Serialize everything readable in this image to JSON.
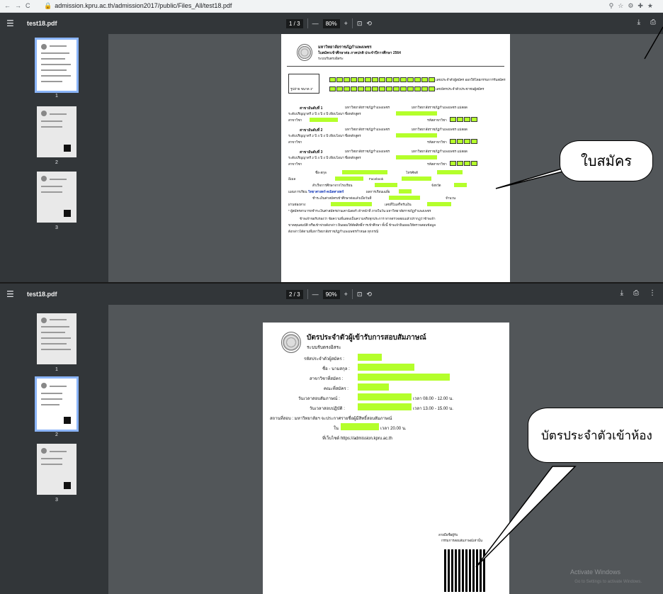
{
  "browser": {
    "url": "admission.kpru.ac.th/admission2017/public/Files_All/test18.pdf"
  },
  "viewer": {
    "filename": "test18.pdf",
    "v1_page": "1",
    "v2_page": "2",
    "page_total": "3",
    "v1_zoom": "80%",
    "v2_zoom": "90%",
    "thumb_labels": [
      "1",
      "2",
      "3"
    ]
  },
  "page1": {
    "uni": "มหาวิทยาลัยราชภัฏกำแพงเพชร",
    "form_title": "ใบสมัครเข้าศึกษาต่อ ภาคปกติ ประจำปีการศึกษา 2564",
    "system": "ระบบรับตรงอิสระ",
    "applicant_id": "เลขประจำตัวผู้สมัคร ออกให้โดยกรรมการรับสมัคร",
    "citizen_id": "เลขบัตรประจำตัวประชาชนผู้สมัคร",
    "photo": "รูปถ่าย ขนาด 1\"",
    "choice1": "สาขาอันดับที่ 1",
    "choice2": "สาขาอันดับที่ 2",
    "choice3": "สาขาอันดับที่ 3",
    "campus_main": "มหาวิทยาลัยราชภัฏกำแพงเพชร",
    "campus_mae_sot": "มหาวิทยาลัยราชภัฏกำแพงเพชร แม่สอด",
    "degree_line": "ระดับปริญญาตรี  2 ปี  4 ปี  4 ปี เทียบโอนฯ ชื่อหลักสูตร",
    "major": "สาขาวิชา",
    "major_code": "รหัสสาขาวิชา",
    "name": "ชื่อ-สกุล",
    "phone": "โทรศัพท์",
    "email": "อีเมล",
    "facebook": "Facebook",
    "school": "สำเร็จการศึกษาจากโรงเรียน",
    "province": "จังหวัด",
    "study_plan": "แผนการเรียน",
    "study_plan_value": "วิทยาศาสตร์-คณิตศาสตร์",
    "gpa": "ผลการเรียนเฉลี่ย",
    "pay_date": "ชำระเงินค่าสมัครเข้าศึกษาต่อแล้วเมื่อวันที่",
    "amount": "จำนวน",
    "via": "ผ่านช่องทาง",
    "receipt": "เลขที่ใบเสร็จรับเงิน",
    "note": "* ผู้สมัครสามารถชำระเงินค่าสมัครผ่านเคาน์เตอร์ เจ้าหน้าที่ ภายในวัน มหาวิทยาลัยราชภัฏกำแพงเพชร",
    "cert1": "ข้าพเจ้าขอรับรองว่า ข้อความที่แสดงเป็นความจริงทุกประการ หากตรวจสอบแล้วปรากฏว่าข้าพเจ้า",
    "cert2": "ขาดคุณสมบัติ หรือเข้าข่ายดังกล่าว ยินยอมให้ตัดสิทธิ์การเข้าศึกษา ทั้งนี้ ข้าพเจ้ายินยอมให้ตรวจสอบข้อมูล",
    "cert3": "ดังกล่าวได้ตามที่มหาวิทยาลัยราชภัฏกำแพงเพชรกำหนด ทุกกรณี"
  },
  "page2": {
    "title": "บัตรประจำตัวผู้เข้ารับการสอบสัมภาษณ์",
    "system": "ระบบรับตรงอิสระ",
    "applicant_id": "รหัสประจำตัวผู้สมัคร :",
    "name": "ชื่อ - นามสกุล :",
    "major": "สาขาวิชาที่สมัคร :",
    "faculty": "คณะที่สมัคร :",
    "interview_date": "วันเวลาสอบสัมภาษณ์ :",
    "interview_time": "เวลา 08.00 - 12.00 น.",
    "practical_date": "วันเวลาสอบปฏิบัติ :",
    "practical_time": "เวลา 13.00 - 15.00 น.",
    "venue": "สถานที่สอบ :  มหาวิทยาลัยฯ จะประกาศรายชื่อผู้มีสิทธิ์สอบสัมภาษณ์",
    "on": "ใน",
    "time20": "เวลา 20.00 น.",
    "website": "ที่เว็บไซต์ https://admission.kpru.ac.th",
    "sign1": "ลายมือชื่อผู้รับ",
    "sign2": "กรรมการสอบสัมภาษณ์เท่านั้น"
  },
  "annotations": {
    "callout1": "ใบสมัคร",
    "callout2": "บัตรประจำตัวเข้าห้อง"
  },
  "watermark": {
    "line1": "Activate Windows",
    "line2": "Go to Settings to activate Windows."
  }
}
